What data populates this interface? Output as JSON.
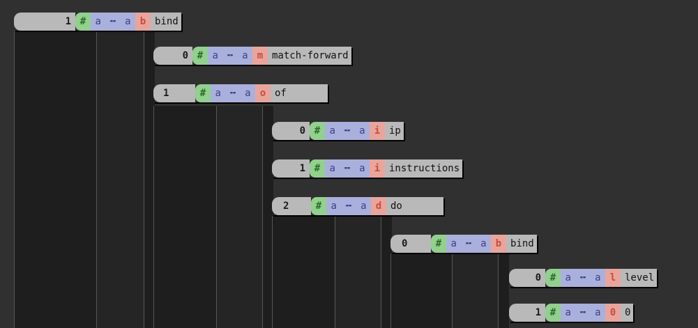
{
  "nodes": [
    {
      "index": "1",
      "hash": "#",
      "sym": [
        "a",
        "╍",
        "a"
      ],
      "tag": "b",
      "label": "bind"
    },
    {
      "index": "0",
      "hash": "#",
      "sym": [
        "a",
        "╍",
        "a"
      ],
      "tag": "m",
      "label": "match-forward"
    },
    {
      "index": "1",
      "hash": "#",
      "sym": [
        "a",
        "╍",
        "a"
      ],
      "tag": "o",
      "label": "of"
    },
    {
      "index": "0",
      "hash": "#",
      "sym": [
        "a",
        "╍",
        "a"
      ],
      "tag": "i",
      "label": "ip"
    },
    {
      "index": "1",
      "hash": "#",
      "sym": [
        "a",
        "╍",
        "a"
      ],
      "tag": "i",
      "label": "instructions"
    },
    {
      "index": "2",
      "hash": "#",
      "sym": [
        "a",
        "╍",
        "a"
      ],
      "tag": "d",
      "label": "do"
    },
    {
      "index": "0",
      "hash": "#",
      "sym": [
        "a",
        "╍",
        "a"
      ],
      "tag": "b",
      "label": "bind"
    },
    {
      "index": "0",
      "hash": "#",
      "sym": [
        "a",
        "╍",
        "a"
      ],
      "tag": "l",
      "label": "level"
    },
    {
      "index": "1",
      "hash": "#",
      "sym": [
        "a",
        "╍",
        "a"
      ],
      "tag": "0",
      "label": "0"
    }
  ],
  "colors": {
    "background": "#303030",
    "index_bg": "#b9b9b9",
    "hash_bg": "#92d08e",
    "symbol_bg": "#aab0dc",
    "tag_bg": "#e8a59c",
    "tag_text": "#cc4a3a"
  }
}
